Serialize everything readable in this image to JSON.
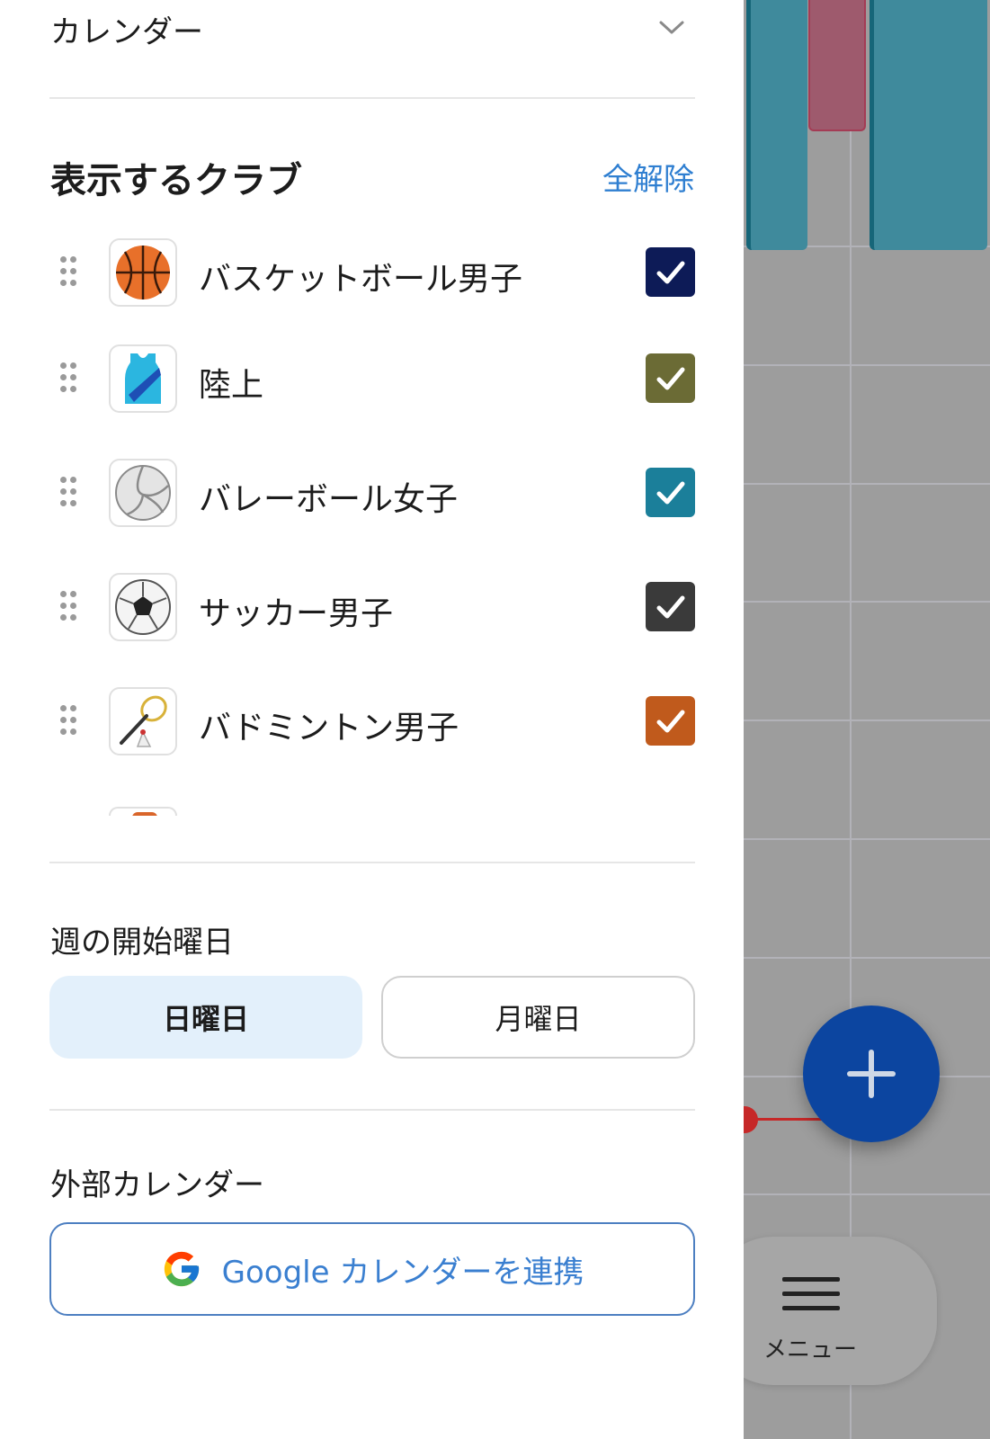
{
  "calendar_section": {
    "title": "カレンダー"
  },
  "clubs_section": {
    "title": "表示するクラブ",
    "clear_all_label": "全解除",
    "clubs": [
      {
        "name": "バスケットボール男子",
        "icon": "basketball-icon",
        "checked": true,
        "color": "#0d1b57"
      },
      {
        "name": "陸上",
        "icon": "running-shirt-icon",
        "checked": true,
        "color": "#6b6b35"
      },
      {
        "name": "バレーボール女子",
        "icon": "volleyball-icon",
        "checked": true,
        "color": "#1b7f9a"
      },
      {
        "name": "サッカー男子",
        "icon": "soccer-ball-icon",
        "checked": true,
        "color": "#3a3a3a"
      },
      {
        "name": "バドミントン男子",
        "icon": "badminton-icon",
        "checked": true,
        "color": "#c05a1c"
      }
    ]
  },
  "week_start_section": {
    "title": "週の開始曜日",
    "options": [
      "日曜日",
      "月曜日"
    ],
    "selected": "日曜日"
  },
  "external_calendar_section": {
    "title": "外部カレンダー",
    "google_button_label": "Google カレンダーを連携"
  },
  "background": {
    "fab_icon": "plus-icon",
    "menu_label": "メニュー",
    "menu_icon": "hamburger-icon"
  },
  "colors": {
    "accent": "#2f7fd1",
    "fab": "#0c45a0",
    "event_teal": "#3f8a9c",
    "event_red": "#9e5a6d",
    "now_line": "#c62828"
  }
}
